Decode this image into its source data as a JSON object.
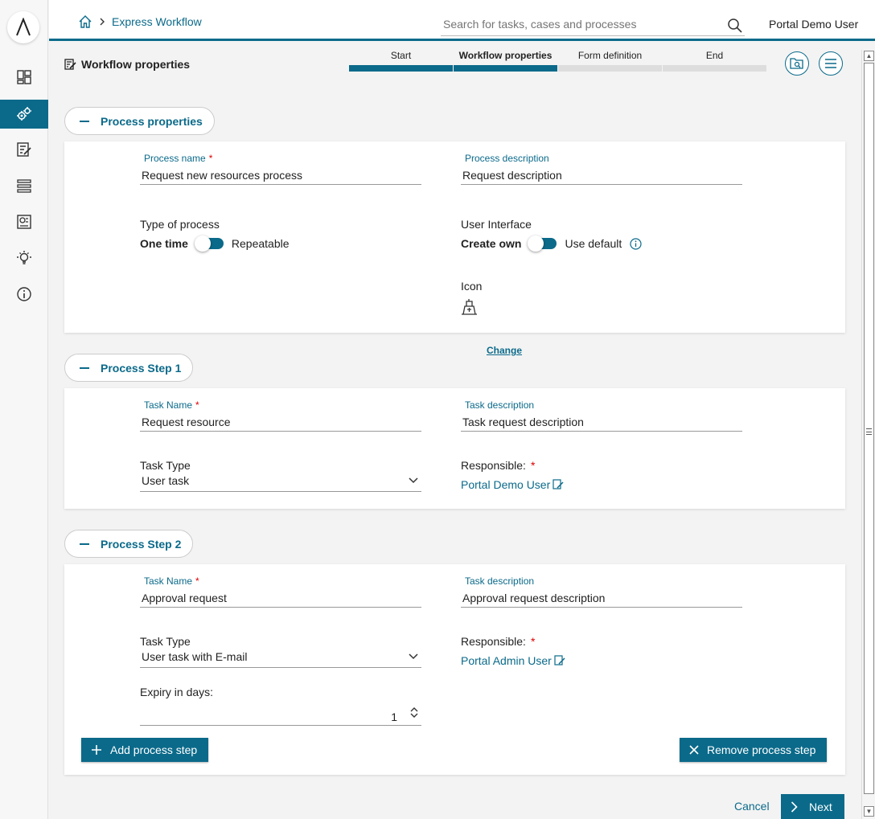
{
  "header": {
    "breadcrumb": "Express Workflow",
    "search_placeholder": "Search for tasks, cases and processes",
    "user": "Portal Demo User"
  },
  "sidebar": {
    "items": [
      "dashboard",
      "express-workflow",
      "tasks",
      "processes",
      "statistics",
      "ideas",
      "about"
    ],
    "active": "express-workflow"
  },
  "page": {
    "title": "Workflow properties",
    "steps": [
      {
        "label": "Start",
        "state": "done"
      },
      {
        "label": "Workflow properties",
        "state": "current"
      },
      {
        "label": "Form definition",
        "state": "todo"
      },
      {
        "label": "End",
        "state": "todo"
      }
    ]
  },
  "process_properties": {
    "heading": "Process properties",
    "name_label": "Process name",
    "name_value": "Request new resources process",
    "description_label": "Process description",
    "description_value": "Request description",
    "type_label": "Type of process",
    "type_on": "One time",
    "type_off": "Repeatable",
    "ui_label": "User Interface",
    "ui_on": "Create own",
    "ui_off": "Use default",
    "icon_label": "Icon",
    "change_link": "Change"
  },
  "step1": {
    "heading": "Process Step 1",
    "task_name_label": "Task Name",
    "task_name_value": "Request resource",
    "task_desc_label": "Task description",
    "task_desc_value": "Task request description",
    "task_type_label": "Task Type",
    "task_type_value": "User task",
    "responsible_label": "Responsible:",
    "responsible_value": "Portal Demo User"
  },
  "step2": {
    "heading": "Process Step 2",
    "task_name_label": "Task Name",
    "task_name_value": "Approval request",
    "task_desc_label": "Task description",
    "task_desc_value": "Approval request description",
    "task_type_label": "Task Type",
    "task_type_value": "User task with E-mail",
    "responsible_label": "Responsible:",
    "responsible_value": "Portal Admin User",
    "expiry_label": "Expiry in days:",
    "expiry_value": "1",
    "add_step": "Add process step",
    "remove_step": "Remove process step"
  },
  "footer": {
    "cancel": "Cancel",
    "next": "Next"
  },
  "colors": {
    "accent": "#0b6a8a",
    "required": "#dd0000"
  }
}
